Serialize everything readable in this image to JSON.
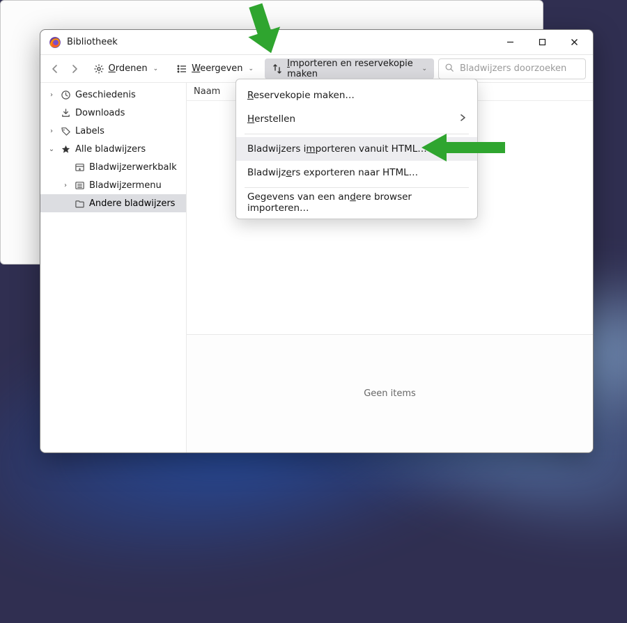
{
  "window": {
    "title": "Bibliotheek"
  },
  "toolbar": {
    "organize_label": "Ordenen",
    "views_label": "Weergeven",
    "import_label": "Importeren en reservekopie maken"
  },
  "search": {
    "placeholder": "Bladwijzers doorzoeken",
    "value": ""
  },
  "sidebar": {
    "items": [
      {
        "label": "Geschiedenis",
        "twisty": "›",
        "icon": "clock"
      },
      {
        "label": "Downloads",
        "twisty": "",
        "icon": "download"
      },
      {
        "label": "Labels",
        "twisty": "›",
        "icon": "tag"
      },
      {
        "label": "Alle bladwijzers",
        "twisty": "⌄",
        "icon": "star"
      },
      {
        "label": "Bladwijzerwerkbalk",
        "twisty": "",
        "icon": "toolbar",
        "depth": 1
      },
      {
        "label": "Bladwijzermenu",
        "twisty": "›",
        "icon": "menu",
        "depth": 1
      },
      {
        "label": "Andere bladwijzers",
        "twisty": "",
        "icon": "folder",
        "depth": 1,
        "selected": true
      }
    ]
  },
  "columns": {
    "name": "Naam"
  },
  "details": {
    "empty": "Geen items"
  },
  "menu": {
    "items": [
      {
        "label": "Reservekopie maken…",
        "accel": "R"
      },
      {
        "label": "Herstellen",
        "accel": "H",
        "submenu": true
      },
      {
        "sep": true
      },
      {
        "label": "Bladwijzers importeren vanuit HTML…",
        "accel": "m",
        "hover": true
      },
      {
        "label": "Bladwijzers exporteren naar HTML…",
        "accel": "e"
      },
      {
        "sep": true
      },
      {
        "label": "Gegevens van een andere browser importeren…",
        "accel": "d"
      }
    ]
  },
  "annotation": {
    "color": "#2fa52f"
  }
}
